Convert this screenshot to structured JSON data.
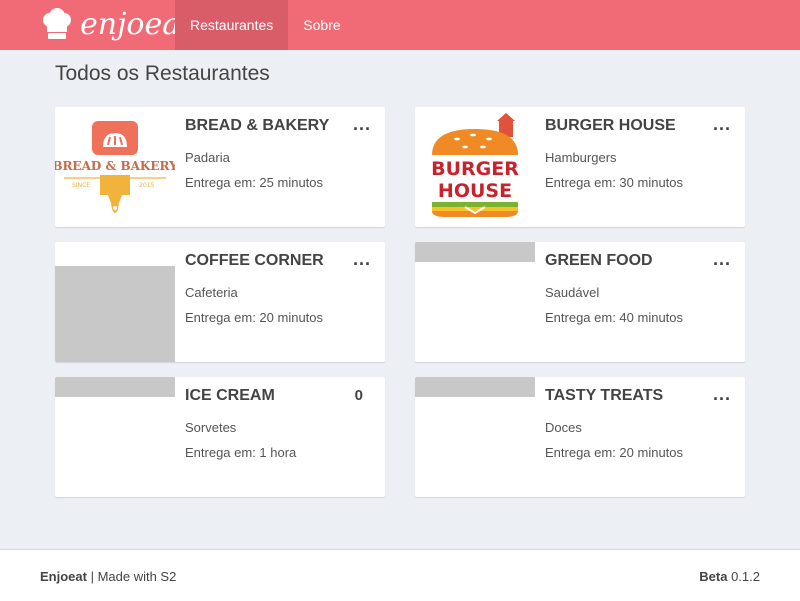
{
  "header": {
    "brand": "enjoeat",
    "nav": [
      {
        "label": "Restaurantes",
        "active": true
      },
      {
        "label": "Sobre",
        "active": false
      }
    ],
    "color": "#f16b77",
    "active_color": "#d95d69"
  },
  "main": {
    "title": "Todos os Restaurantes",
    "restaurants": [
      {
        "name": "BREAD & BAKERY",
        "category": "Padaria",
        "delivery": "Entrega em: 25 minutos",
        "menu": "...",
        "logo": {
          "line1": "BREAD & BAKERY",
          "line2": "SINCE",
          "line3": "2015"
        }
      },
      {
        "name": "BURGER HOUSE",
        "category": "Hamburgers",
        "delivery": "Entrega em: 30 minutos",
        "menu": "...",
        "logo": {
          "line1": "BURGER",
          "line2": "HOUSE"
        }
      },
      {
        "name": "COFFEE CORNER",
        "category": "Cafeteria",
        "delivery": "Entrega em: 20 minutos",
        "menu": "..."
      },
      {
        "name": "GREEN FOOD",
        "category": "Saudável",
        "delivery": "Entrega em: 40 minutos",
        "menu": "..."
      },
      {
        "name": "ICE CREAM",
        "category": "Sorvetes",
        "delivery": "Entrega em: 1 hora",
        "count": "0"
      },
      {
        "name": "TASTY TREATS",
        "category": "Doces",
        "delivery": "Entrega em: 20 minutos",
        "menu": "..."
      }
    ]
  },
  "footer": {
    "brand": "Enjoeat",
    "made_with": " | Made with S2",
    "stage": "Beta",
    "version": " 0.1.2"
  }
}
